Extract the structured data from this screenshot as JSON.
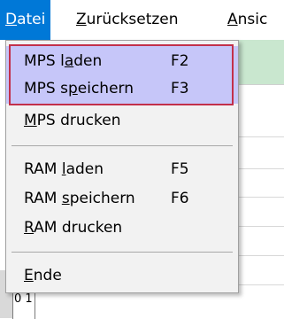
{
  "menubar": {
    "items": [
      {
        "label": "Datei",
        "active": true
      },
      {
        "label": "Zurücksetzen",
        "active": false
      },
      {
        "label": "Ansic",
        "active": false
      }
    ]
  },
  "dropdown": {
    "items": [
      {
        "label": "MPS laden",
        "shortcut": "F2",
        "highlighted": true
      },
      {
        "label": "MPS speichern",
        "shortcut": "F3",
        "highlighted": true
      },
      {
        "label": "MPS drucken",
        "shortcut": "",
        "highlighted": false
      },
      {
        "label": "RAM laden",
        "shortcut": "F5",
        "highlighted": false
      },
      {
        "label": "RAM speichern",
        "shortcut": "F6",
        "highlighted": false
      },
      {
        "label": "RAM drucken",
        "shortcut": "",
        "highlighted": false
      },
      {
        "label": "Ende",
        "shortcut": "",
        "highlighted": false
      }
    ]
  },
  "background": {
    "cell_text": "0 1"
  },
  "colors": {
    "menubar_active_bg": "#0078d7",
    "menu_highlight_bg": "#c6c6f9",
    "selection_frame": "#c2304b",
    "app_green": "#c9e7cf"
  }
}
